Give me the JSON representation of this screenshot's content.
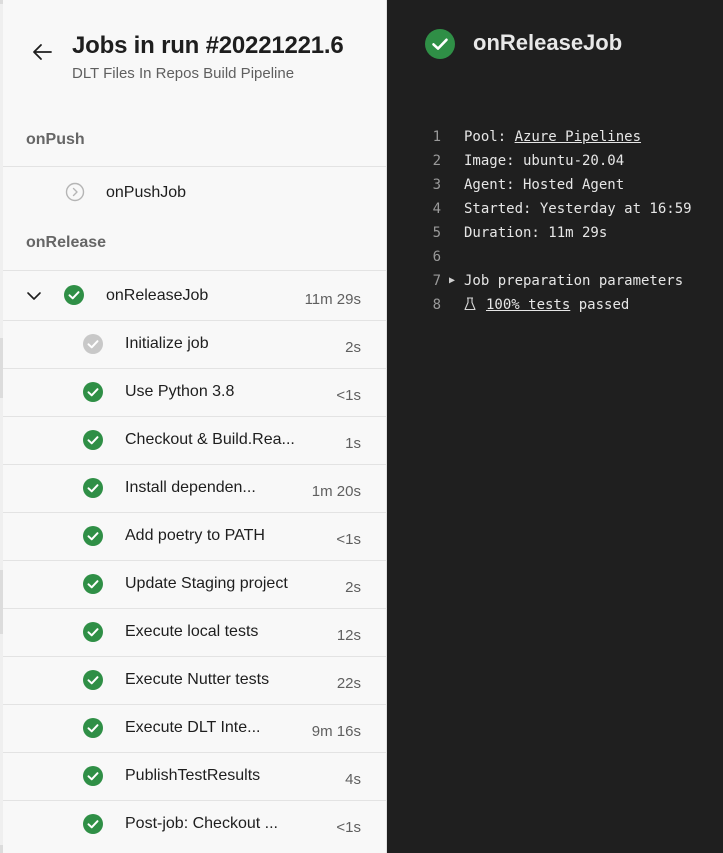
{
  "run": {
    "title": "Jobs in run #20221221.6",
    "subtitle": "DLT Files In Repos Build Pipeline"
  },
  "stages": [
    {
      "name": "onPush"
    },
    {
      "name": "onRelease"
    }
  ],
  "jobs": {
    "onPushJob": {
      "label": "onPushJob",
      "status": "skipped"
    },
    "onReleaseJob": {
      "label": "onReleaseJob",
      "duration": "11m 29s",
      "status": "succeeded",
      "expanded": true
    }
  },
  "steps": [
    {
      "label": "Initialize job",
      "duration": "2s",
      "status": "neutral"
    },
    {
      "label": "Use Python 3.8",
      "duration": "<1s",
      "status": "succeeded"
    },
    {
      "label": "Checkout & Build.Rea...",
      "duration": "1s",
      "status": "succeeded"
    },
    {
      "label": "Install dependen...",
      "duration": "1m 20s",
      "status": "succeeded"
    },
    {
      "label": "Add poetry to PATH",
      "duration": "<1s",
      "status": "succeeded"
    },
    {
      "label": "Update Staging project",
      "duration": "2s",
      "status": "succeeded"
    },
    {
      "label": "Execute local tests",
      "duration": "12s",
      "status": "succeeded"
    },
    {
      "label": "Execute Nutter tests",
      "duration": "22s",
      "status": "succeeded"
    },
    {
      "label": "Execute DLT Inte...",
      "duration": "9m 16s",
      "status": "succeeded"
    },
    {
      "label": "PublishTestResults",
      "duration": "4s",
      "status": "succeeded"
    },
    {
      "label": "Post-job: Checkout ...",
      "duration": "<1s",
      "status": "succeeded"
    }
  ],
  "detail": {
    "title": "onReleaseJob",
    "log": [
      {
        "n": "1",
        "key": "Pool: ",
        "link": "Azure Pipelines"
      },
      {
        "n": "2",
        "text": "Image: ubuntu-20.04"
      },
      {
        "n": "3",
        "text": "Agent: Hosted Agent"
      },
      {
        "n": "4",
        "text": "Started: Yesterday at 16:59"
      },
      {
        "n": "5",
        "text": "Duration: 11m 29s"
      },
      {
        "n": "6",
        "text": ""
      },
      {
        "n": "7",
        "text": "Job preparation parameters"
      },
      {
        "n": "8",
        "link": "100% tests",
        "suffix": " passed"
      }
    ]
  },
  "colors": {
    "success": "#2f8f46",
    "neutral": "#c8c8c8",
    "panel_dark": "#1f1f1f"
  },
  "icons": {
    "back": "arrow-left-icon",
    "success": "check-circle-icon",
    "skipped": "skip-circle-icon",
    "neutral": "neutral-check-icon",
    "expand": "chevron-down-icon",
    "flask": "flask-icon",
    "triangle": "triangle-right-icon"
  }
}
